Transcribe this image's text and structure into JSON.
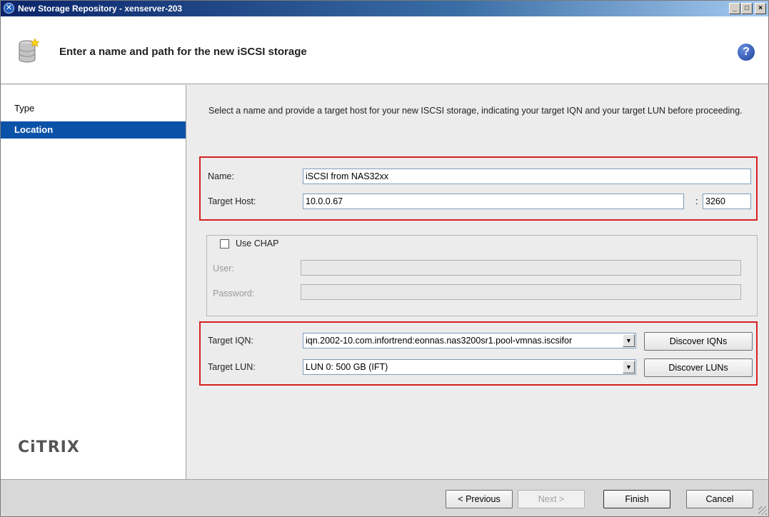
{
  "window": {
    "title": "New Storage Repository - xenserver-203"
  },
  "header": {
    "heading": "Enter a name and path for the new iSCSI storage"
  },
  "sidebar": {
    "items": [
      {
        "label": "Type",
        "selected": false
      },
      {
        "label": "Location",
        "selected": true
      }
    ],
    "logo": "CiTRIX"
  },
  "main": {
    "description": "Select a name and provide a target host for your new ISCSI storage, indicating your target IQN and your target LUN before proceeding.",
    "name_label": "Name:",
    "name_value": "iSCSI from NAS32xx",
    "host_label": "Target Host:",
    "host_value": "10.0.0.67",
    "port_sep": ":",
    "port_value": "3260",
    "chap": {
      "label": "Use CHAP",
      "checked": false,
      "user_label": "User:",
      "user_value": "",
      "password_label": "Password:",
      "password_value": ""
    },
    "iqn_label": "Target IQN:",
    "iqn_value": "iqn.2002-10.com.infortrend:eonnas.nas3200sr1.pool-vmnas.iscsifor",
    "discover_iqns": "Discover IQNs",
    "lun_label": "Target LUN:",
    "lun_value": "LUN 0: 500 GB (IFT)",
    "discover_luns": "Discover LUNs"
  },
  "footer": {
    "previous": "< Previous",
    "next": "Next >",
    "finish": "Finish",
    "cancel": "Cancel"
  },
  "colors": {
    "highlight": "#d62020",
    "selection": "#0a52a8"
  }
}
